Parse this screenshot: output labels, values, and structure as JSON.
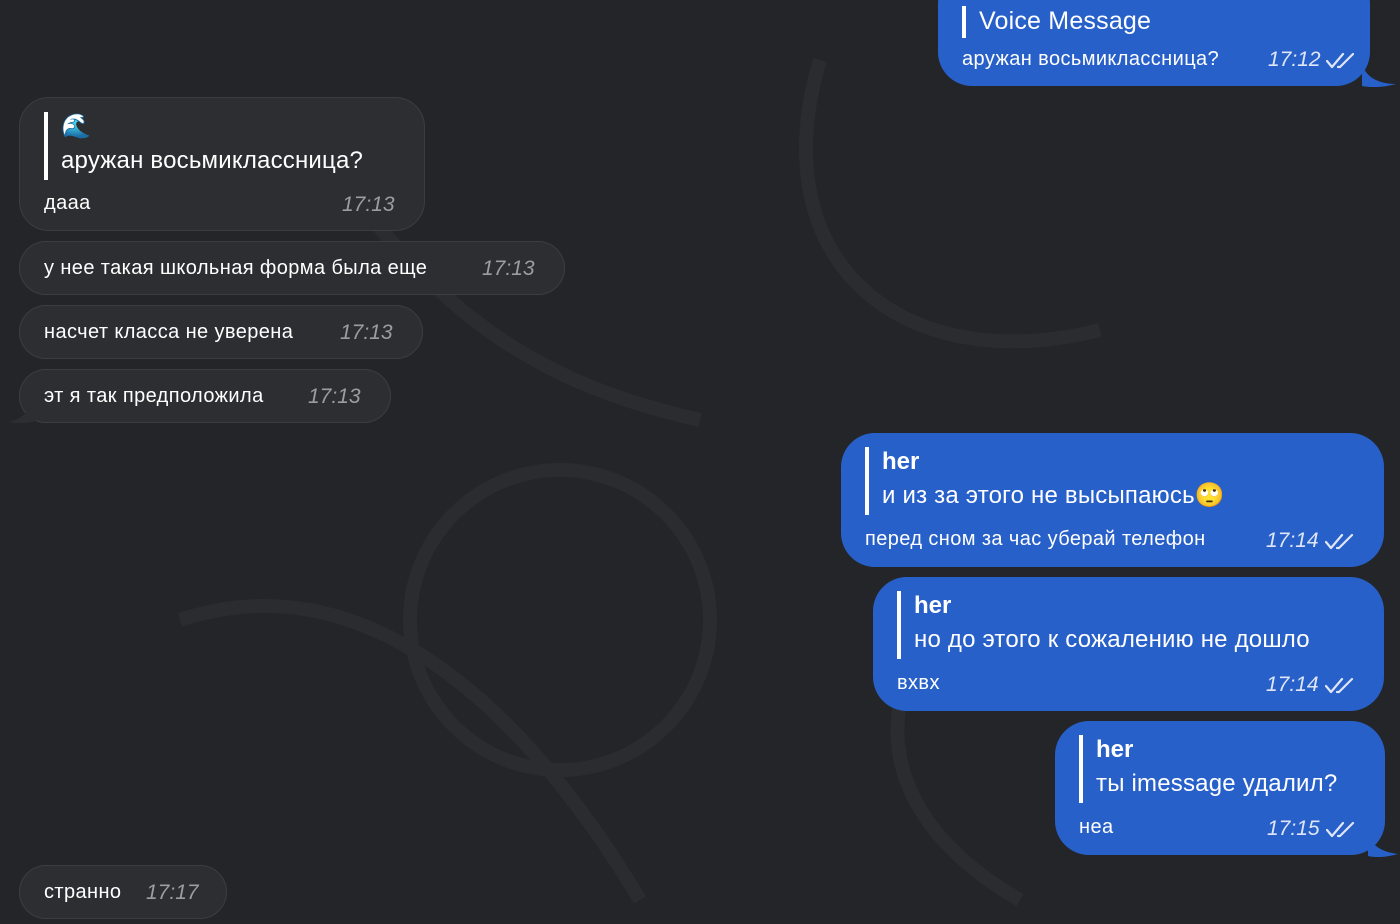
{
  "chat": {
    "messages": [
      {
        "id": "m1",
        "dir": "out",
        "reply_title": "Voice Message",
        "text": "аружан восьмиклассница?",
        "time": "17:12",
        "status": "read-double-check-icon"
      },
      {
        "id": "m2",
        "dir": "in",
        "reply_emoji": "🌊",
        "reply_text": "аружан восьмиклассница?",
        "text": "дааа",
        "time": "17:13"
      },
      {
        "id": "m3",
        "dir": "in",
        "text": "у нее такая школьная форма была еще",
        "time": "17:13"
      },
      {
        "id": "m4",
        "dir": "in",
        "text": "насчет класса не уверена",
        "time": "17:13"
      },
      {
        "id": "m5",
        "dir": "in",
        "text": "эт я так предположила",
        "time": "17:13"
      },
      {
        "id": "m6",
        "dir": "out",
        "reply_sender": "her",
        "reply_text": "и из за этого не высыпаюсь🙄",
        "text": "перед сном за час уберай телефон",
        "time": "17:14",
        "status": "read-double-check-icon"
      },
      {
        "id": "m7",
        "dir": "out",
        "reply_sender": "her",
        "reply_text": "но до этого к сожалению не дошло",
        "text": "вхвх",
        "time": "17:14",
        "status": "read-double-check-icon"
      },
      {
        "id": "m8",
        "dir": "out",
        "reply_sender": "her",
        "reply_text": "ты imessage удалил?",
        "text": "неа",
        "time": "17:15",
        "status": "read-double-check-icon"
      },
      {
        "id": "m9",
        "dir": "in",
        "text": "странно",
        "time": "17:17"
      }
    ]
  },
  "colors": {
    "background": "#232528",
    "outgoing_bubble": "#2860c9",
    "incoming_bubble": "#2d2e31",
    "incoming_time": "#9c9da1"
  }
}
